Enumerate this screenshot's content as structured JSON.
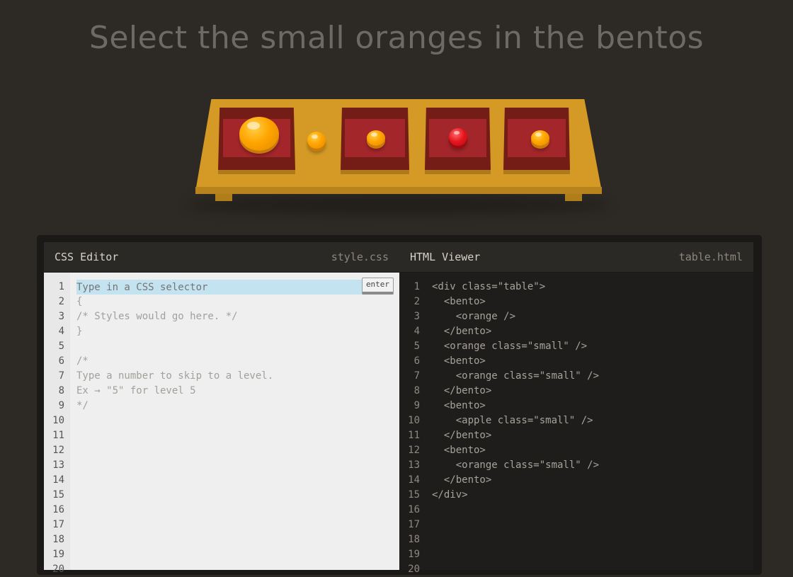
{
  "instruction": "Select the small oranges in the bentos",
  "css_editor": {
    "title": "CSS Editor",
    "filename": "style.css",
    "input_placeholder": "Type in a CSS selector",
    "enter_label": "enter",
    "lines": [
      "",
      "{",
      "/* Styles would go here. */",
      "}",
      "",
      "/*",
      "Type a number to skip to a level.",
      "Ex → \"5\" for level 5",
      "*/"
    ],
    "line_numbers": [
      "1",
      "2",
      "3",
      "4",
      "5",
      "6",
      "7",
      "8",
      "9",
      "10",
      "11",
      "12",
      "13",
      "14",
      "15",
      "16",
      "17",
      "18",
      "19",
      "20"
    ]
  },
  "html_viewer": {
    "title": "HTML Viewer",
    "filename": "table.html",
    "lines": [
      "<div class=\"table\">",
      "  <bento>",
      "    <orange />",
      "  </bento>",
      "  <orange class=\"small\" />",
      "  <bento>",
      "    <orange class=\"small\" />",
      "  </bento>",
      "  <bento>",
      "    <apple class=\"small\" />",
      "  </bento>",
      "  <bento>",
      "    <orange class=\"small\" />",
      "  </bento>",
      "</div>"
    ],
    "line_numbers": [
      "1",
      "2",
      "3",
      "4",
      "5",
      "6",
      "7",
      "8",
      "9",
      "10",
      "11",
      "12",
      "13",
      "14",
      "15",
      "16",
      "17",
      "18",
      "19",
      "20"
    ]
  },
  "table_items": [
    {
      "element": "bento",
      "contains": "orange"
    },
    {
      "element": "orange",
      "class": "small"
    },
    {
      "element": "bento",
      "contains": "orange",
      "contains_class": "small"
    },
    {
      "element": "bento",
      "contains": "apple",
      "contains_class": "small"
    },
    {
      "element": "bento",
      "contains": "orange",
      "contains_class": "small"
    }
  ],
  "colors": {
    "background": "#2d2a25",
    "table": "#d49a25",
    "bento_rim": "#741d17",
    "bento_inner": "#a3262a",
    "orange": "#ffa500",
    "apple": "#e5141c",
    "selector_highlight": "#c3e3f0"
  }
}
